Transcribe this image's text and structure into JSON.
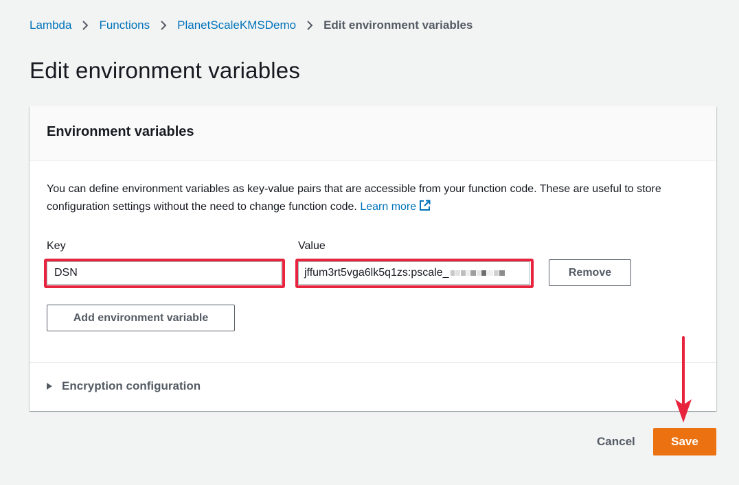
{
  "breadcrumb": {
    "items": [
      {
        "label": "Lambda"
      },
      {
        "label": "Functions"
      },
      {
        "label": "PlanetScaleKMSDemo"
      }
    ],
    "current": "Edit environment variables"
  },
  "page": {
    "title": "Edit environment variables"
  },
  "panel": {
    "title": "Environment variables",
    "description": "You can define environment variables as key-value pairs that are accessible from your function code. These are useful to store configuration settings without the need to change function code.",
    "learn_more": "Learn more",
    "key_label": "Key",
    "value_label": "Value",
    "variables": [
      {
        "key": "DSN",
        "value": "jffum3rt5vga6lk5q1zs:pscale_"
      }
    ],
    "remove_label": "Remove",
    "add_label": "Add environment variable",
    "encryption_label": "Encryption configuration"
  },
  "footer": {
    "cancel_label": "Cancel",
    "save_label": "Save"
  },
  "colors": {
    "accent": "#ec7211",
    "link": "#0073bb",
    "highlight": "#e8233d"
  }
}
